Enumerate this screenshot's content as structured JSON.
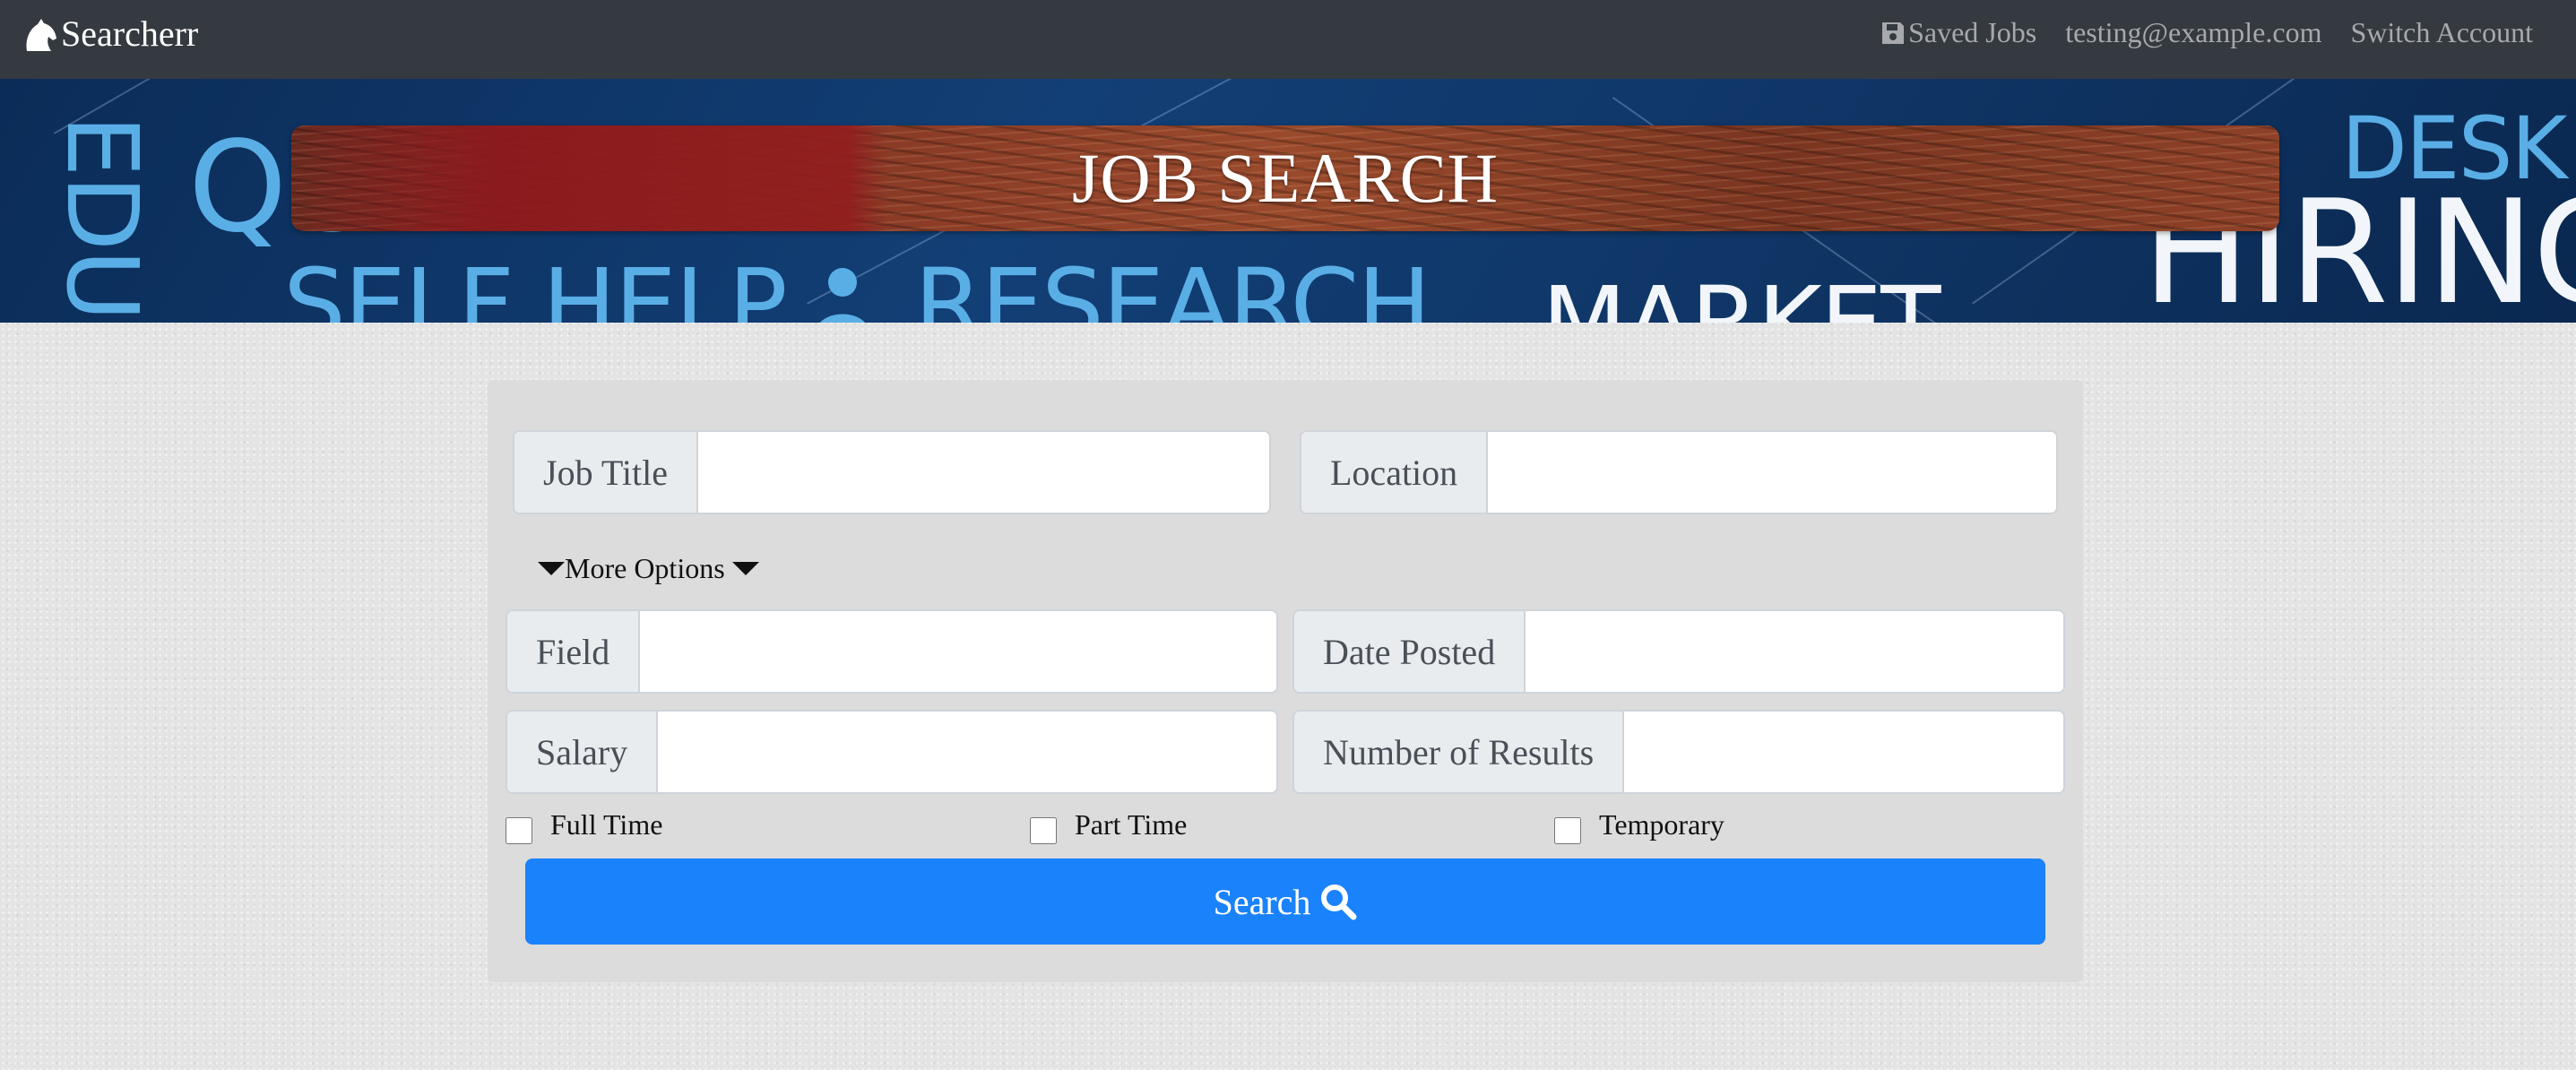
{
  "navbar": {
    "brand": "Searcherr",
    "saved_jobs": "Saved Jobs",
    "user_email": "testing@example.com",
    "switch_account": "Switch Account"
  },
  "banner": {
    "title": "JOB SEARCH",
    "background_words": [
      "EDU",
      "QU",
      "SELF HELP",
      "RESEARCH",
      "MARKET",
      "DESK",
      "HIRING"
    ]
  },
  "form": {
    "job_title_label": "Job Title",
    "job_title_value": "",
    "location_label": "Location",
    "location_value": "",
    "more_options": "More Options",
    "field_label": "Field",
    "field_value": "",
    "date_posted_label": "Date Posted",
    "date_posted_value": "",
    "salary_label": "Salary",
    "salary_value": "",
    "num_results_label": "Number of Results",
    "num_results_value": "",
    "full_time": "Full Time",
    "part_time": "Part Time",
    "temporary": "Temporary",
    "search_button": "Search"
  },
  "icons": {
    "brand": "horse-head-icon",
    "saved_jobs": "floppy-disk-icon",
    "search": "search-icon",
    "more_options": "caret-down-icon"
  },
  "colors": {
    "navbar_bg": "#343a40",
    "primary": "#1a82fb",
    "panel_bg": "#dcdcdc"
  }
}
